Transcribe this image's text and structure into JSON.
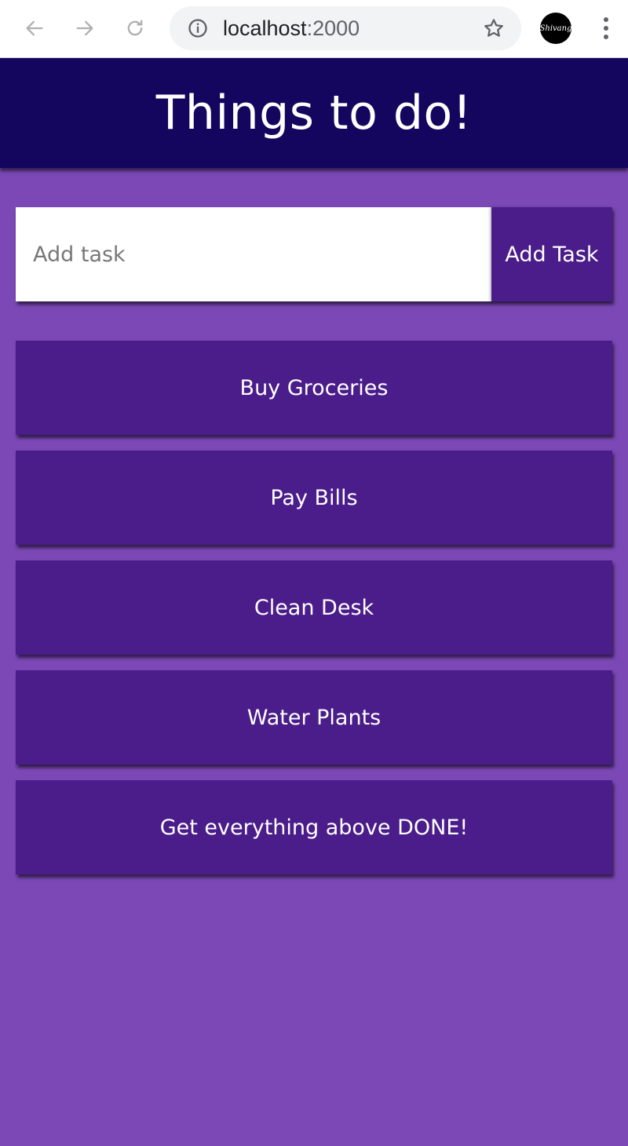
{
  "browser": {
    "url_host": "localhost",
    "url_port": ":2000",
    "profile_label": "Shivang"
  },
  "header": {
    "title": "Things to do!"
  },
  "add_task": {
    "placeholder": "Add task",
    "value": "",
    "button_label": "Add Task"
  },
  "tasks": [
    {
      "label": "Buy Groceries"
    },
    {
      "label": "Pay Bills"
    },
    {
      "label": "Clean Desk"
    },
    {
      "label": "Water Plants"
    },
    {
      "label": "Get everything above DONE!"
    }
  ],
  "colors": {
    "header_bg": "#14065e",
    "page_bg": "#7b48b6",
    "item_bg": "#4a1d8a",
    "text": "#ffffff"
  },
  "icons": {
    "back": "arrow-left-icon",
    "forward": "arrow-right-icon",
    "reload": "reload-icon",
    "info": "info-icon",
    "bookmark": "star-icon",
    "menu": "kebab-menu-icon"
  }
}
